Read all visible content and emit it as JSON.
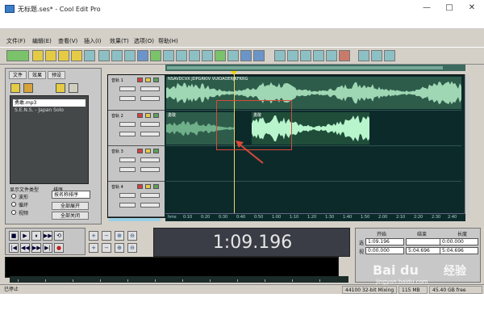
{
  "window": {
    "title": "无标题.ses* - Cool Edit Pro",
    "controls": [
      "—",
      "□",
      "✕"
    ]
  },
  "menu": [
    "文件(F)",
    "编辑(E)",
    "查看(V)",
    "插入(I)",
    "效果(T)",
    "选项(O)",
    "帮助(H)"
  ],
  "left_panel": {
    "tabs": [
      "文件",
      "效果",
      "预设"
    ],
    "files": [
      "勇敢.mp3",
      "S.E.N.S. - Japan Solo"
    ],
    "sort_label": "显示文件类型",
    "sort_by_label": "排序",
    "options": [
      "波形",
      "循环",
      "视频"
    ],
    "sort_value": "按名称排序",
    "buttons": [
      "全部展开",
      "全部关闭"
    ]
  },
  "tracks": {
    "names": [
      "音轨 1",
      "音轨 2",
      "音轨 3",
      "音轨 4"
    ],
    "clip1_label": "NSAVDCVX JDPGRKIV VUIOAOERJKFKRG",
    "clip2_label": "勇敢",
    "clip3_label": "勇敢"
  },
  "ruler": {
    "ticks": [
      "hms",
      "0:10",
      "0:20",
      "0:30",
      "0:40",
      "0:50",
      "1:00",
      "1:10",
      "1:20",
      "1:30",
      "1:40",
      "1:50",
      "2:00",
      "2:10",
      "2:20",
      "2:30",
      "2:40"
    ],
    "end_label": "hms"
  },
  "transport": [
    "■",
    "▶",
    "⏸",
    "▶▶",
    "⟲",
    "|◀",
    "◀◀",
    "▶▶",
    "▶|",
    "●"
  ],
  "zoom_icons": [
    "+",
    "−",
    "+",
    "−",
    "⊕",
    "⊖"
  ],
  "time_display": "1:09.196",
  "info": {
    "headers": [
      "开始",
      "结束",
      "长度"
    ],
    "row_labels": [
      "选",
      "视"
    ],
    "sel": [
      "1:09.196",
      "",
      "0:00.000"
    ],
    "view": [
      "0:00.000",
      "5:04.696",
      "5:04.696"
    ]
  },
  "meter_scale": [
    "-69",
    "-63",
    "-57",
    "-51",
    "-45",
    "-39",
    "-33",
    "-27",
    "-21",
    "-15",
    "-9",
    "-3"
  ],
  "status": {
    "left": "已停止",
    "format": "44100 32-bit Mixing",
    "size": "115 MB",
    "disk": "45.40 GB free"
  },
  "watermark": {
    "brand": "Bai du",
    "cn": "经验",
    "url": "jingyan.baidu.com"
  },
  "colors": {
    "wave_main": "#9fd7b4",
    "wave_dim": "#5f9d78",
    "track_bg": "#0d2a2a",
    "highlight": "#d84a3a"
  }
}
